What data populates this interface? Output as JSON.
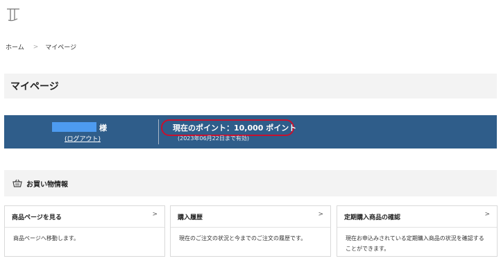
{
  "breadcrumb": {
    "home": "ホーム",
    "separator": ">",
    "current": "マイページ"
  },
  "page_title": "マイページ",
  "user": {
    "honorific": "様",
    "logout": "(ログアウト)"
  },
  "points": {
    "text": "現在のポイント：10,000 ポイント",
    "expiry": "(2023年06月22日まで有効)"
  },
  "shopping_section": {
    "title": "お買い物情報",
    "icon": "basket-icon"
  },
  "cards": [
    {
      "title": "商品ページを見る",
      "description": "商品ページへ移動します。"
    },
    {
      "title": "購入履歴",
      "description": "現在のご注文の状況と今までのご注文の履歴です。"
    },
    {
      "title": "定期購入商品の確認",
      "description": "現在お申込みされている定期購入商品の状況を確認することができます。"
    }
  ],
  "colors": {
    "points_bar": "#2f5d8a",
    "highlight": "#c8102e",
    "name_mask": "#4d9bf0"
  }
}
